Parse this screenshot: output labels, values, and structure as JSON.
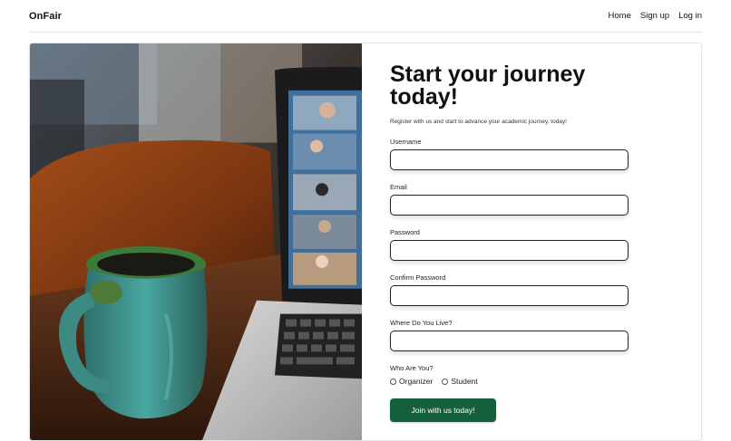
{
  "nav": {
    "brand": "OnFair",
    "links": [
      "Home",
      "Sign up",
      "Log in"
    ]
  },
  "hero": {
    "image_alt": "Mug beside a laptop showing a video call"
  },
  "form": {
    "title": "Start your journey today!",
    "subtitle": "Register with us and start to advance your academic journey, today!",
    "fields": [
      {
        "label": "Username",
        "value": ""
      },
      {
        "label": "Email",
        "value": ""
      },
      {
        "label": "Password",
        "value": ""
      },
      {
        "label": "Confirm Password",
        "value": ""
      },
      {
        "label": "Where Do You Live?",
        "value": ""
      }
    ],
    "who_label": "Who Are You?",
    "options": [
      "Organizer",
      "Student"
    ],
    "submit_label": "Join with us today!"
  },
  "colors": {
    "accent": "#15603a",
    "input_border": "#222222"
  }
}
